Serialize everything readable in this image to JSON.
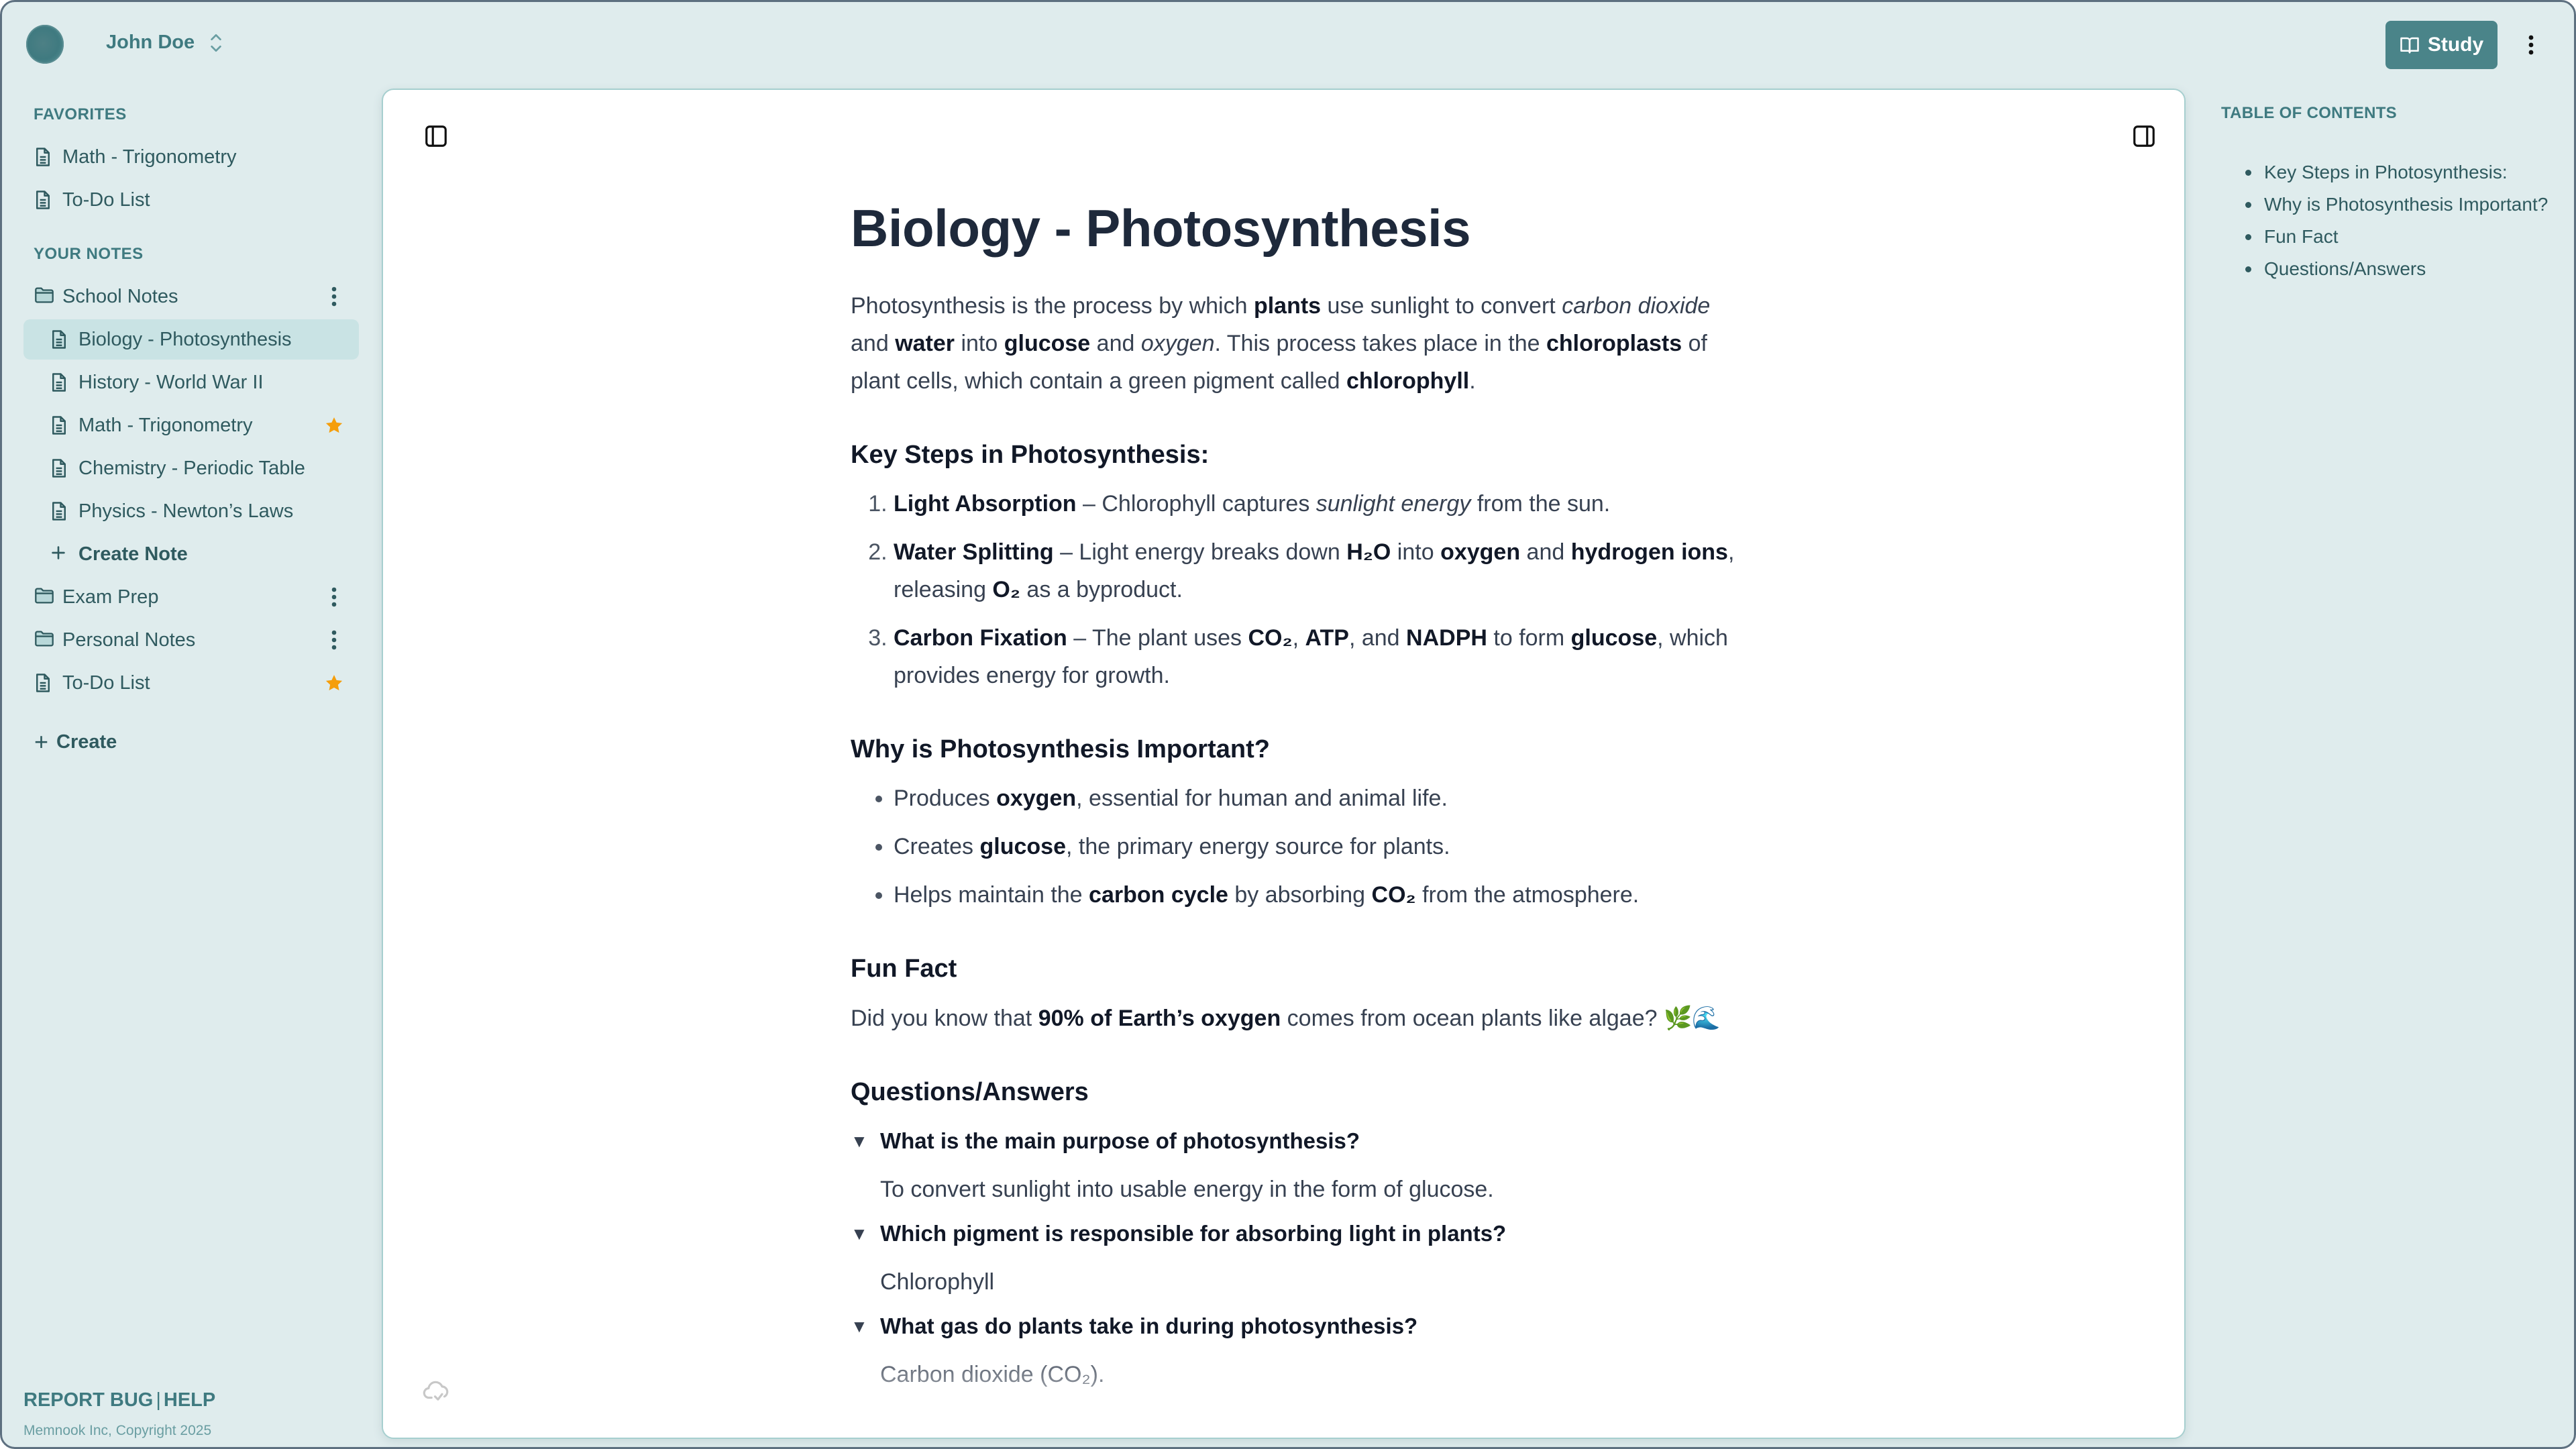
{
  "user": {
    "name": "John Doe"
  },
  "topbar": {
    "study_label": "Study"
  },
  "sidebar": {
    "favorites_label": "FAVORITES",
    "favorites": [
      {
        "label": "Math - Trigonometry",
        "icon": "document-icon"
      },
      {
        "label": "To-Do List",
        "icon": "document-icon"
      }
    ],
    "your_notes_label": "YOUR NOTES",
    "notes": [
      {
        "label": "School Notes",
        "icon": "folder-icon",
        "level": 0,
        "trailing": "more-icon"
      },
      {
        "label": "Biology - Photosynthesis",
        "icon": "document-icon",
        "level": 1,
        "selected": true
      },
      {
        "label": "History - World War II",
        "icon": "document-icon",
        "level": 1
      },
      {
        "label": "Math - Trigonometry",
        "icon": "document-icon",
        "level": 1,
        "trailing": "star-icon"
      },
      {
        "label": "Chemistry - Periodic Table",
        "icon": "document-icon",
        "level": 1
      },
      {
        "label": "Physics - Newton’s Laws",
        "icon": "document-icon",
        "level": 1
      },
      {
        "label": "Create Note",
        "icon": "plus-icon",
        "level": 1
      },
      {
        "label": "Exam Prep",
        "icon": "folder-icon",
        "level": 0,
        "trailing": "more-icon"
      },
      {
        "label": "Personal Notes",
        "icon": "folder-icon",
        "level": 0,
        "trailing": "more-icon"
      },
      {
        "label": "To-Do List",
        "icon": "document-icon",
        "level": 0,
        "trailing": "star-icon"
      }
    ],
    "create_label": "Create",
    "report_bug_label": "REPORT BUG",
    "separator": "|",
    "help_label": "HELP",
    "copyright": "Memnook Inc, Copyright 2025"
  },
  "colors": {
    "accent": "#4a8489",
    "sidebar_bg": "#dfeced",
    "selected_bg": "#c9e3e4",
    "star": "#f59e0b",
    "text_dark": "#111827"
  },
  "document": {
    "title": "Biology - Photosynthesis",
    "intro": [
      {
        "t": "Photosynthesis is the process by which "
      },
      {
        "t": "plants",
        "s": "b"
      },
      {
        "t": " use sunlight to convert "
      },
      {
        "t": "carbon dioxide",
        "s": "i"
      },
      {
        "t": " and "
      },
      {
        "t": "water",
        "s": "b"
      },
      {
        "t": " into "
      },
      {
        "t": "glucose",
        "s": "b"
      },
      {
        "t": " and "
      },
      {
        "t": "oxygen",
        "s": "i"
      },
      {
        "t": ". This process takes place in the "
      },
      {
        "t": "chloroplasts",
        "s": "b"
      },
      {
        "t": " of plant cells, which contain a green pigment called "
      },
      {
        "t": "chlorophyll",
        "s": "b"
      },
      {
        "t": "."
      }
    ],
    "key_steps_heading": "Key Steps in Photosynthesis:",
    "key_steps": [
      [
        {
          "t": "Light Absorption",
          "s": "b"
        },
        {
          "t": " – Chlorophyll captures "
        },
        {
          "t": "sunlight energy",
          "s": "i"
        },
        {
          "t": " from the sun."
        }
      ],
      [
        {
          "t": "Water Splitting",
          "s": "b"
        },
        {
          "t": " – Light energy breaks down "
        },
        {
          "t": "H₂O",
          "s": "b"
        },
        {
          "t": " into "
        },
        {
          "t": "oxygen",
          "s": "b"
        },
        {
          "t": " and "
        },
        {
          "t": "hydrogen ions",
          "s": "b"
        },
        {
          "t": ", releasing "
        },
        {
          "t": "O₂",
          "s": "b"
        },
        {
          "t": " as a byproduct."
        }
      ],
      [
        {
          "t": "Carbon Fixation",
          "s": "b"
        },
        {
          "t": " – The plant uses "
        },
        {
          "t": "CO₂",
          "s": "b"
        },
        {
          "t": ", "
        },
        {
          "t": "ATP",
          "s": "b"
        },
        {
          "t": ", and "
        },
        {
          "t": "NADPH",
          "s": "b"
        },
        {
          "t": " to form "
        },
        {
          "t": "glucose",
          "s": "b"
        },
        {
          "t": ", which provides energy for growth."
        }
      ]
    ],
    "importance_heading": "Why is Photosynthesis Important?",
    "importance": [
      [
        {
          "t": "Produces "
        },
        {
          "t": "oxygen",
          "s": "b"
        },
        {
          "t": ", essential for human and animal life."
        }
      ],
      [
        {
          "t": "Creates "
        },
        {
          "t": "glucose",
          "s": "b"
        },
        {
          "t": ", the primary energy source for plants."
        }
      ],
      [
        {
          "t": "Helps maintain the "
        },
        {
          "t": "carbon cycle",
          "s": "b"
        },
        {
          "t": " by absorbing "
        },
        {
          "t": "CO₂",
          "s": "b"
        },
        {
          "t": " from the atmosphere."
        }
      ]
    ],
    "fun_fact_heading": "Fun Fact",
    "fun_fact": [
      {
        "t": "Did you know that "
      },
      {
        "t": "90% of Earth’s oxygen",
        "s": "b"
      },
      {
        "t": " comes from ocean plants like algae? 🌿🌊"
      }
    ],
    "qa_heading": "Questions/Answers",
    "qa": [
      {
        "q": "What is the main purpose of photosynthesis?",
        "a": "To convert sunlight into usable energy in the form of glucose."
      },
      {
        "q": "Which pigment is responsible for absorbing light in plants?",
        "a": "Chlorophyll"
      },
      {
        "q": "What gas do plants take in during photosynthesis?",
        "a": "Carbon dioxide (CO₂)."
      }
    ],
    "qa_toggle_glyph": "▼"
  },
  "toc": {
    "title": "TABLE OF CONTENTS",
    "items": [
      "Key Steps in Photosynthesis:",
      "Why is Photosynthesis Important?",
      "Fun Fact",
      "Questions/Answers"
    ]
  }
}
